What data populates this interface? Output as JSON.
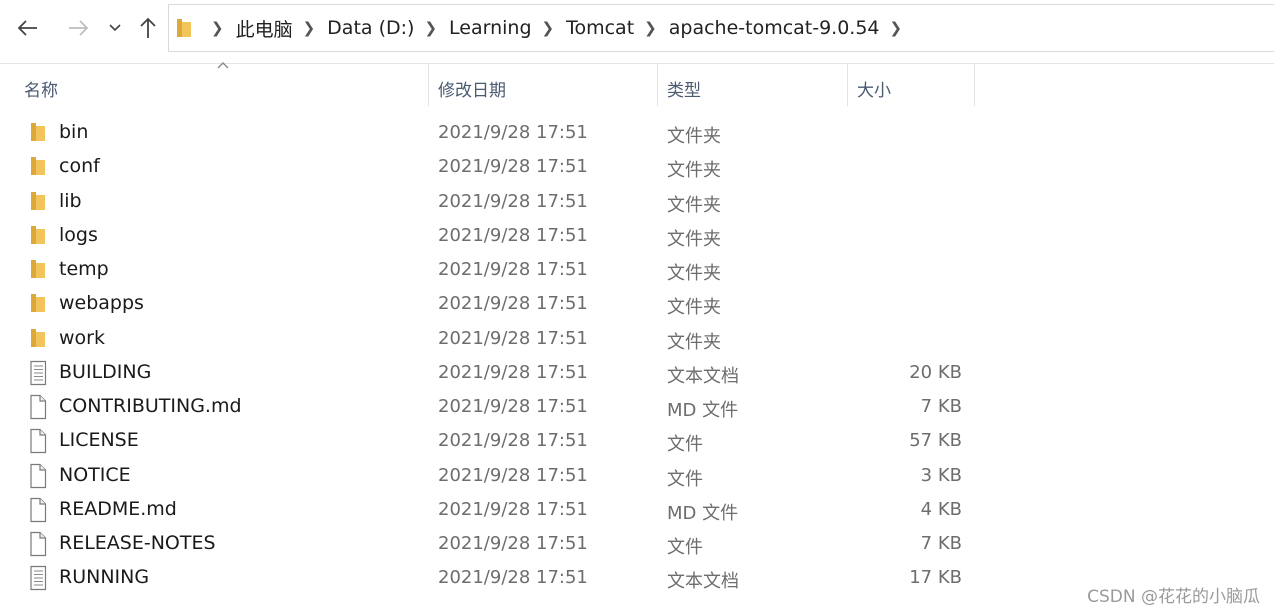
{
  "breadcrumb": [
    "此电脑",
    "Data (D:)",
    "Learning",
    "Tomcat",
    "apache-tomcat-9.0.54"
  ],
  "columns": {
    "name": "名称",
    "date": "修改日期",
    "type": "类型",
    "size": "大小"
  },
  "files": [
    {
      "name": "bin",
      "date": "2021/9/28 17:51",
      "type": "文件夹",
      "size": "",
      "icon": "folder-icon"
    },
    {
      "name": "conf",
      "date": "2021/9/28 17:51",
      "type": "文件夹",
      "size": "",
      "icon": "folder-icon"
    },
    {
      "name": "lib",
      "date": "2021/9/28 17:51",
      "type": "文件夹",
      "size": "",
      "icon": "folder-icon"
    },
    {
      "name": "logs",
      "date": "2021/9/28 17:51",
      "type": "文件夹",
      "size": "",
      "icon": "folder-icon"
    },
    {
      "name": "temp",
      "date": "2021/9/28 17:51",
      "type": "文件夹",
      "size": "",
      "icon": "folder-icon"
    },
    {
      "name": "webapps",
      "date": "2021/9/28 17:51",
      "type": "文件夹",
      "size": "",
      "icon": "folder-icon"
    },
    {
      "name": "work",
      "date": "2021/9/28 17:51",
      "type": "文件夹",
      "size": "",
      "icon": "folder-icon"
    },
    {
      "name": "BUILDING",
      "date": "2021/9/28 17:51",
      "type": "文本文档",
      "size": "20 KB",
      "icon": "text-document-icon"
    },
    {
      "name": "CONTRIBUTING.md",
      "date": "2021/9/28 17:51",
      "type": "MD 文件",
      "size": "7 KB",
      "icon": "file-icon"
    },
    {
      "name": "LICENSE",
      "date": "2021/9/28 17:51",
      "type": "文件",
      "size": "57 KB",
      "icon": "file-icon"
    },
    {
      "name": "NOTICE",
      "date": "2021/9/28 17:51",
      "type": "文件",
      "size": "3 KB",
      "icon": "file-icon"
    },
    {
      "name": "README.md",
      "date": "2021/9/28 17:51",
      "type": "MD 文件",
      "size": "4 KB",
      "icon": "file-icon"
    },
    {
      "name": "RELEASE-NOTES",
      "date": "2021/9/28 17:51",
      "type": "文件",
      "size": "7 KB",
      "icon": "file-icon"
    },
    {
      "name": "RUNNING",
      "date": "2021/9/28 17:51",
      "type": "文本文档",
      "size": "17 KB",
      "icon": "text-document-icon"
    }
  ],
  "watermark": "CSDN @花花的小脑瓜",
  "colors": {
    "folder": "#f2c55c",
    "folder_dark": "#dca83a",
    "header_text": "#4a5a70"
  }
}
